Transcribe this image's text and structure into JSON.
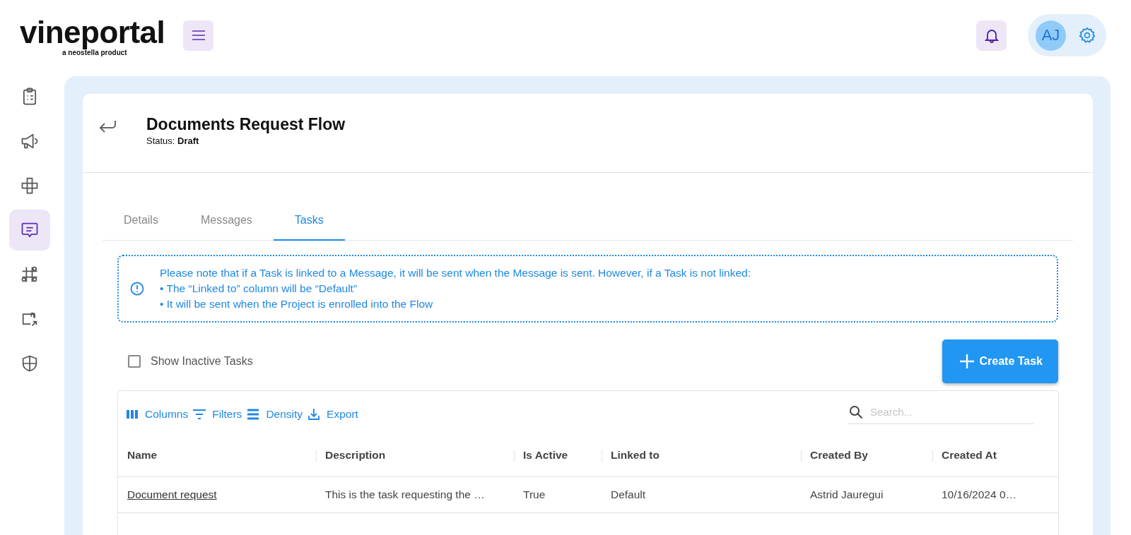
{
  "logo": {
    "name": "vineportal",
    "tagline": "a neostella product"
  },
  "user": {
    "initials": "AJ"
  },
  "sidebar": {
    "items": [
      {
        "kind": "clipboard",
        "selected": false
      },
      {
        "kind": "megaphone",
        "selected": false
      },
      {
        "kind": "flow",
        "selected": false
      },
      {
        "kind": "message",
        "selected": true
      },
      {
        "kind": "grid",
        "selected": false
      },
      {
        "kind": "export",
        "selected": false
      },
      {
        "kind": "shield",
        "selected": false
      }
    ]
  },
  "page": {
    "title": "Documents Request Flow",
    "status_label": "Status:",
    "status": "Draft"
  },
  "tabs": [
    {
      "label": "Details",
      "selected": false
    },
    {
      "label": "Messages",
      "selected": false
    },
    {
      "label": "Tasks",
      "selected": true
    }
  ],
  "notice": {
    "lines": [
      "Please note that if a Task is linked to a Message, it will be sent when the Message is sent. However, if a Task is not linked:",
      "• The “Linked to” column will be “Default”",
      "• It will be sent when the Project is enrolled into the Flow"
    ]
  },
  "show_inactive": {
    "label": "Show Inactive Tasks",
    "checked": false
  },
  "create_button": {
    "label": "Create Task"
  },
  "toolbar": [
    {
      "kind": "columns",
      "label": "Columns"
    },
    {
      "kind": "filters",
      "label": "Filters"
    },
    {
      "kind": "density",
      "label": "Density"
    },
    {
      "kind": "export",
      "label": "Export"
    }
  ],
  "search": {
    "placeholder": "Search..."
  },
  "table": {
    "columns": [
      "Name",
      "Description",
      "Is Active",
      "Linked to",
      "Created By",
      "Created At"
    ],
    "rows": [
      [
        "Document request",
        "This is the task requesting the …",
        "True",
        "Default",
        "Astrid Jauregui",
        "10/16/2024 0…"
      ]
    ]
  }
}
